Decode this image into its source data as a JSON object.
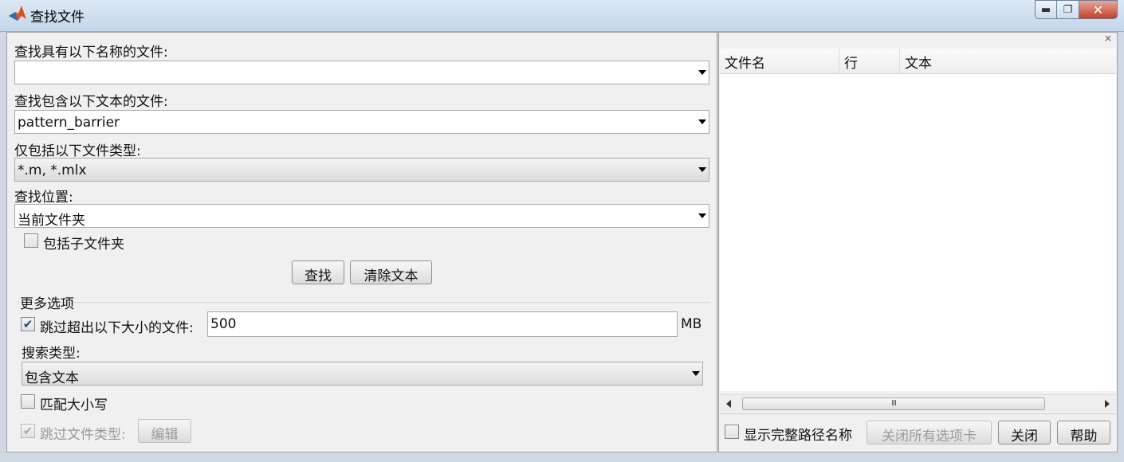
{
  "window": {
    "title": "查找文件",
    "min_symbol": "▬",
    "max_symbol": "❐",
    "close_symbol": "✕"
  },
  "search": {
    "name_label": "查找具有以下名称的文件:",
    "name_value": "",
    "text_label": "查找包含以下文本的文件:",
    "text_value": "pattern_barrier",
    "type_label": "仅包括以下文件类型:",
    "type_value": "*.m, *.mlx",
    "location_label": "查找位置:",
    "location_value": "当前文件夹",
    "subfolders_label": "包括子文件夹",
    "subfolders_checked": false,
    "find_button": "查找",
    "clear_button": "清除文本"
  },
  "more_options": {
    "heading": "更多选项",
    "skip_size_label": "跳过超出以下大小的文件:",
    "skip_size_checked": true,
    "skip_size_value": "500",
    "skip_size_unit": "MB",
    "search_type_label": "搜索类型:",
    "search_type_value": "包含文本",
    "match_case_label": "匹配大小写",
    "match_case_checked": false,
    "skip_types_label": "跳过文件类型:",
    "skip_types_checked": true,
    "edit_button": "编辑"
  },
  "results": {
    "panel_close": "×",
    "columns": [
      "文件名",
      "行",
      "文本"
    ],
    "scroll_grip": "III"
  },
  "footer": {
    "show_full_path_label": "显示完整路径名称",
    "show_full_path_checked": false,
    "close_all_tabs_button": "关闭所有选项卡",
    "close_button": "关闭",
    "help_button": "帮助"
  }
}
